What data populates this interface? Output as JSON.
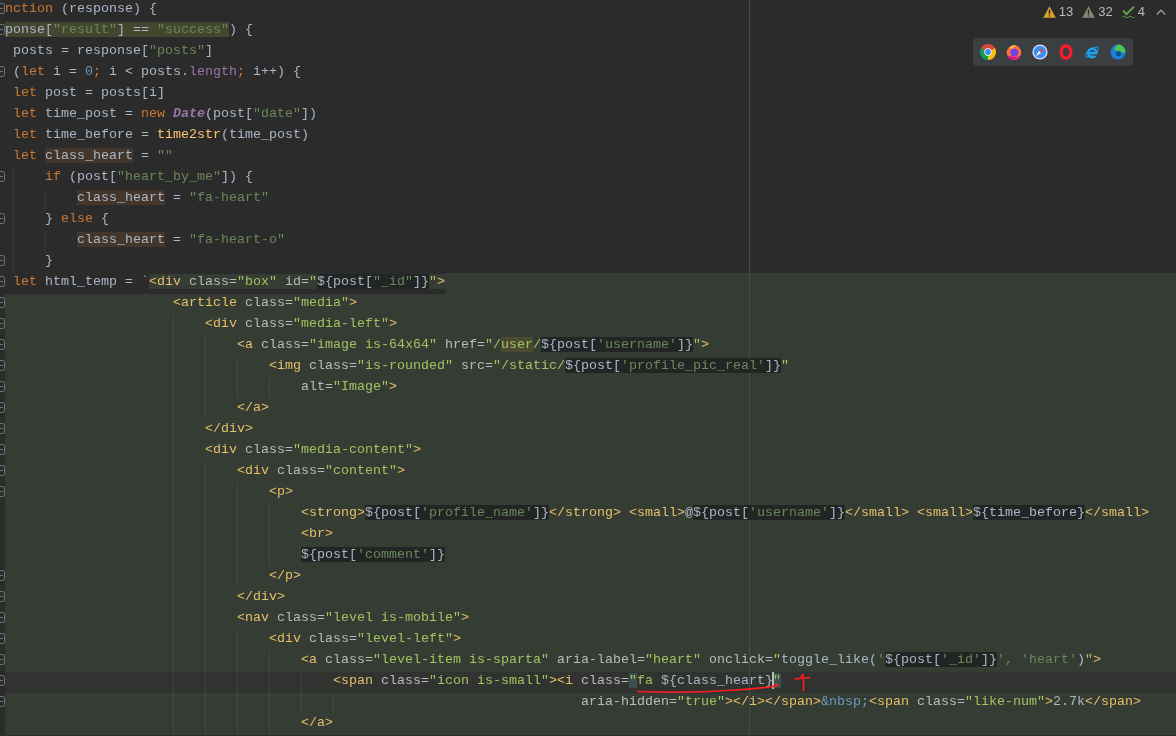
{
  "editor": {
    "lines": [
      {
        "injected": false,
        "current": false,
        "fold_marker": true,
        "tokens": [
          {
            "kind": "keyword",
            "text": "nction"
          },
          {
            "kind": "plain",
            "text": " (response) {"
          }
        ]
      },
      {
        "injected": false,
        "current": false,
        "fold_marker": true,
        "tokens": [
          {
            "kind": "scope",
            "text": "ponse["
          },
          {
            "kind": "scope_string",
            "text": "\"result\""
          },
          {
            "kind": "scope",
            "text": "] == "
          },
          {
            "kind": "scope_string",
            "text": "\"success\""
          },
          {
            "kind": "plain",
            "text": ") {"
          }
        ]
      },
      {
        "injected": false,
        "current": false,
        "fold_marker": false,
        "tokens": [
          {
            "kind": "plain",
            "text": " posts = response["
          },
          {
            "kind": "string",
            "text": "\"posts\""
          },
          {
            "kind": "plain",
            "text": "]"
          }
        ]
      },
      {
        "injected": false,
        "current": false,
        "fold_marker": true,
        "tokens": [
          {
            "kind": "plain",
            "text": " ("
          },
          {
            "kind": "keyword",
            "text": "let"
          },
          {
            "kind": "plain",
            "text": " i = "
          },
          {
            "kind": "number",
            "text": "0"
          },
          {
            "kind": "keyword",
            "text": ";"
          },
          {
            "kind": "plain",
            "text": " i < posts."
          },
          {
            "kind": "field",
            "text": "length"
          },
          {
            "kind": "keyword",
            "text": ";"
          },
          {
            "kind": "plain",
            "text": " i++) {"
          }
        ]
      },
      {
        "injected": false,
        "current": false,
        "fold_marker": false,
        "tokens": [
          {
            "kind": "keyword",
            "text": " let "
          },
          {
            "kind": "plain",
            "text": "post = posts[i]"
          }
        ]
      },
      {
        "injected": false,
        "current": false,
        "fold_marker": false,
        "tokens": [
          {
            "kind": "keyword",
            "text": " let "
          },
          {
            "kind": "plain",
            "text": "time_post = "
          },
          {
            "kind": "keyword",
            "text": "new "
          },
          {
            "kind": "class",
            "text": "Date"
          },
          {
            "kind": "plain",
            "text": "(post["
          },
          {
            "kind": "string",
            "text": "\"date\""
          },
          {
            "kind": "plain",
            "text": "])"
          }
        ]
      },
      {
        "injected": false,
        "current": false,
        "fold_marker": false,
        "tokens": [
          {
            "kind": "keyword",
            "text": " let "
          },
          {
            "kind": "plain",
            "text": "time_before = "
          },
          {
            "kind": "function",
            "text": "time2str"
          },
          {
            "kind": "plain",
            "text": "(time_post)"
          }
        ]
      },
      {
        "injected": false,
        "current": false,
        "fold_marker": false,
        "tokens": [
          {
            "kind": "keyword",
            "text": " let "
          },
          {
            "kind": "usage",
            "text": "class_heart"
          },
          {
            "kind": "plain",
            "text": " = "
          },
          {
            "kind": "string",
            "text": "\"\""
          }
        ]
      },
      {
        "injected": false,
        "current": false,
        "fold_marker": true,
        "tokens": [
          {
            "kind": "keyword",
            "text": "     if "
          },
          {
            "kind": "plain",
            "text": "(post["
          },
          {
            "kind": "string",
            "text": "\"heart_by_me\""
          },
          {
            "kind": "plain",
            "text": "]) {"
          }
        ]
      },
      {
        "injected": false,
        "current": false,
        "fold_marker": false,
        "tokens": [
          {
            "kind": "usage",
            "text": "         class_heart"
          },
          {
            "kind": "plain",
            "text": " = "
          },
          {
            "kind": "string",
            "text": "\"fa-heart\""
          }
        ]
      },
      {
        "injected": false,
        "current": false,
        "fold_marker": true,
        "tokens": [
          {
            "kind": "plain",
            "text": "     } "
          },
          {
            "kind": "keyword",
            "text": "else "
          },
          {
            "kind": "plain",
            "text": "{"
          }
        ]
      },
      {
        "injected": false,
        "current": false,
        "fold_marker": false,
        "tokens": [
          {
            "kind": "usage",
            "text": "         class_heart"
          },
          {
            "kind": "plain",
            "text": " = "
          },
          {
            "kind": "string",
            "text": "\"fa-heart-o\""
          }
        ]
      },
      {
        "injected": false,
        "current": false,
        "fold_marker": true,
        "tokens": [
          {
            "kind": "plain",
            "text": "     }"
          }
        ]
      },
      {
        "injected": false,
        "current": false,
        "fold_marker": true,
        "tokens": [
          {
            "kind": "keyword",
            "text": " let "
          },
          {
            "kind": "plain",
            "text": "html_temp = `"
          },
          {
            "kind": "tag",
            "text": "<div"
          },
          {
            "kind": "attr",
            "text": " class="
          },
          {
            "kind": "value",
            "text": "\"box\""
          },
          {
            "kind": "attr",
            "text": " id="
          },
          {
            "kind": "value",
            "text": "\""
          },
          {
            "kind": "interp",
            "text": "${post["
          },
          {
            "kind": "interp_string",
            "text": "\"_id\""
          },
          {
            "kind": "interp",
            "text": "]}"
          },
          {
            "kind": "value",
            "text": "\""
          },
          {
            "kind": "tag",
            "text": ">"
          }
        ]
      },
      {
        "injected": true,
        "current": false,
        "fold_marker": true,
        "tokens": [
          {
            "kind": "tag",
            "text": "                     <article"
          },
          {
            "kind": "attr",
            "text": " class="
          },
          {
            "kind": "value",
            "text": "\"media\""
          },
          {
            "kind": "tag",
            "text": ">"
          }
        ]
      },
      {
        "injected": true,
        "current": false,
        "fold_marker": true,
        "tokens": [
          {
            "kind": "tag",
            "text": "                         <div"
          },
          {
            "kind": "attr",
            "text": " class="
          },
          {
            "kind": "value",
            "text": "\"media-left\""
          },
          {
            "kind": "tag",
            "text": ">"
          }
        ]
      },
      {
        "injected": true,
        "current": false,
        "fold_marker": true,
        "tokens": [
          {
            "kind": "tag",
            "text": "                             <a"
          },
          {
            "kind": "attr",
            "text": " class="
          },
          {
            "kind": "value",
            "text": "\"image is-64x64\""
          },
          {
            "kind": "attr",
            "text": " href="
          },
          {
            "kind": "value",
            "text": "\"/"
          },
          {
            "kind": "scope_value",
            "text": "user"
          },
          {
            "kind": "value",
            "text": "/"
          },
          {
            "kind": "interp",
            "text": "${post["
          },
          {
            "kind": "interp_string",
            "text": "'username'"
          },
          {
            "kind": "interp",
            "text": "]}"
          },
          {
            "kind": "value",
            "text": "\""
          },
          {
            "kind": "tag",
            "text": ">"
          }
        ]
      },
      {
        "injected": true,
        "current": false,
        "fold_marker": true,
        "tokens": [
          {
            "kind": "tag",
            "text": "                                 <img"
          },
          {
            "kind": "attr",
            "text": " class="
          },
          {
            "kind": "value",
            "text": "\"is-rounded\""
          },
          {
            "kind": "attr",
            "text": " src="
          },
          {
            "kind": "value",
            "text": "\"/static/"
          },
          {
            "kind": "interp",
            "text": "${post["
          },
          {
            "kind": "interp_string",
            "text": "'profile_pic_real'"
          },
          {
            "kind": "interp",
            "text": "]}"
          },
          {
            "kind": "value",
            "text": "\""
          }
        ]
      },
      {
        "injected": true,
        "current": false,
        "fold_marker": true,
        "tokens": [
          {
            "kind": "attr",
            "text": "                                     alt="
          },
          {
            "kind": "value",
            "text": "\"Image\""
          },
          {
            "kind": "tag",
            "text": ">"
          }
        ]
      },
      {
        "injected": true,
        "current": false,
        "fold_marker": true,
        "tokens": [
          {
            "kind": "tag",
            "text": "                             </a>"
          }
        ]
      },
      {
        "injected": true,
        "current": false,
        "fold_marker": true,
        "tokens": [
          {
            "kind": "tag",
            "text": "                         </div>"
          }
        ]
      },
      {
        "injected": true,
        "current": false,
        "fold_marker": true,
        "tokens": [
          {
            "kind": "tag",
            "text": "                         <div"
          },
          {
            "kind": "attr",
            "text": " class="
          },
          {
            "kind": "value",
            "text": "\"media-content\""
          },
          {
            "kind": "tag",
            "text": ">"
          }
        ]
      },
      {
        "injected": true,
        "current": false,
        "fold_marker": true,
        "tokens": [
          {
            "kind": "tag",
            "text": "                             <div"
          },
          {
            "kind": "attr",
            "text": " class="
          },
          {
            "kind": "value",
            "text": "\"content\""
          },
          {
            "kind": "tag",
            "text": ">"
          }
        ]
      },
      {
        "injected": true,
        "current": false,
        "fold_marker": true,
        "tokens": [
          {
            "kind": "tag",
            "text": "                                 <p>"
          }
        ]
      },
      {
        "injected": true,
        "current": false,
        "fold_marker": false,
        "tokens": [
          {
            "kind": "tag",
            "text": "                                     <strong>"
          },
          {
            "kind": "interp",
            "text": "${post["
          },
          {
            "kind": "interp_string",
            "text": "'profile_name'"
          },
          {
            "kind": "interp",
            "text": "]}"
          },
          {
            "kind": "tag",
            "text": "</strong> <small>"
          },
          {
            "kind": "text",
            "text": "@"
          },
          {
            "kind": "interp",
            "text": "${post["
          },
          {
            "kind": "interp_string",
            "text": "'username'"
          },
          {
            "kind": "interp",
            "text": "]}"
          },
          {
            "kind": "tag",
            "text": "</small> <small>"
          },
          {
            "kind": "interp",
            "text": "${time_before}"
          },
          {
            "kind": "tag",
            "text": "</small>"
          }
        ]
      },
      {
        "injected": true,
        "current": false,
        "fold_marker": false,
        "tokens": [
          {
            "kind": "tag",
            "text": "                                     <br>"
          }
        ]
      },
      {
        "injected": true,
        "current": false,
        "fold_marker": false,
        "tokens": [
          {
            "kind": "interp",
            "text": "                                     ${post["
          },
          {
            "kind": "interp_string",
            "text": "'comment'"
          },
          {
            "kind": "interp",
            "text": "]}"
          }
        ]
      },
      {
        "injected": true,
        "current": false,
        "fold_marker": true,
        "tokens": [
          {
            "kind": "tag",
            "text": "                                 </p>"
          }
        ]
      },
      {
        "injected": true,
        "current": false,
        "fold_marker": true,
        "tokens": [
          {
            "kind": "tag",
            "text": "                             </div>"
          }
        ]
      },
      {
        "injected": true,
        "current": false,
        "fold_marker": true,
        "tokens": [
          {
            "kind": "tag",
            "text": "                             <nav"
          },
          {
            "kind": "attr",
            "text": " class="
          },
          {
            "kind": "value",
            "text": "\"level is-mobile\""
          },
          {
            "kind": "tag",
            "text": ">"
          }
        ]
      },
      {
        "injected": true,
        "current": false,
        "fold_marker": true,
        "tokens": [
          {
            "kind": "tag",
            "text": "                                 <div"
          },
          {
            "kind": "attr",
            "text": " class="
          },
          {
            "kind": "value",
            "text": "\"level-left\""
          },
          {
            "kind": "tag",
            "text": ">"
          }
        ]
      },
      {
        "injected": true,
        "current": false,
        "fold_marker": true,
        "tokens": [
          {
            "kind": "tag",
            "text": "                                     <a"
          },
          {
            "kind": "attr",
            "text": " class="
          },
          {
            "kind": "value",
            "text": "\"level-item is-sparta\""
          },
          {
            "kind": "attr",
            "text": " aria-label="
          },
          {
            "kind": "value",
            "text": "\"heart\""
          },
          {
            "kind": "attr",
            "text": " onclick="
          },
          {
            "kind": "value",
            "text": "\""
          },
          {
            "kind": "plain",
            "text": "toggle_like("
          },
          {
            "kind": "string",
            "text": "'"
          },
          {
            "kind": "interp",
            "text": "${post["
          },
          {
            "kind": "interp_string",
            "text": "'_id'"
          },
          {
            "kind": "interp",
            "text": "]}"
          },
          {
            "kind": "string",
            "text": "', 'heart'"
          },
          {
            "kind": "plain",
            "text": ")"
          },
          {
            "kind": "value",
            "text": "\""
          },
          {
            "kind": "tag",
            "text": ">"
          }
        ]
      },
      {
        "injected": true,
        "current": true,
        "fold_marker": true,
        "tokens": [
          {
            "kind": "tag",
            "text": "                                         <span"
          },
          {
            "kind": "attr",
            "text": " class="
          },
          {
            "kind": "value",
            "text": "\"icon is-small\""
          },
          {
            "kind": "tag",
            "text": "><i"
          },
          {
            "kind": "attr",
            "text": " class="
          },
          {
            "kind": "match_value",
            "text": "\""
          },
          {
            "kind": "value",
            "text": "fa "
          },
          {
            "kind": "plain",
            "text": "${class_heart}"
          },
          {
            "kind": "match_value",
            "text": "\"",
            "caret_before": true
          }
        ]
      },
      {
        "injected": true,
        "current": false,
        "fold_marker": true,
        "tokens": [
          {
            "kind": "attr",
            "text": "                                                                        aria-hidden="
          },
          {
            "kind": "value",
            "text": "\"true\""
          },
          {
            "kind": "tag",
            "text": "></i></span>"
          },
          {
            "kind": "entity",
            "text": "&nbsp;"
          },
          {
            "kind": "tag",
            "text": "<span"
          },
          {
            "kind": "attr",
            "text": " class="
          },
          {
            "kind": "value",
            "text": "\"like-num\""
          },
          {
            "kind": "tag",
            "text": ">"
          },
          {
            "kind": "text",
            "text": "2.7k"
          },
          {
            "kind": "tag",
            "text": "</span>"
          }
        ]
      },
      {
        "injected": true,
        "current": false,
        "fold_marker": false,
        "tokens": [
          {
            "kind": "tag",
            "text": "                                     </a>"
          }
        ]
      }
    ]
  },
  "inspections": [
    {
      "kind": "warning",
      "count": "13"
    },
    {
      "kind": "weak_warning",
      "count": "32"
    },
    {
      "kind": "typo",
      "count": "4"
    }
  ]
}
